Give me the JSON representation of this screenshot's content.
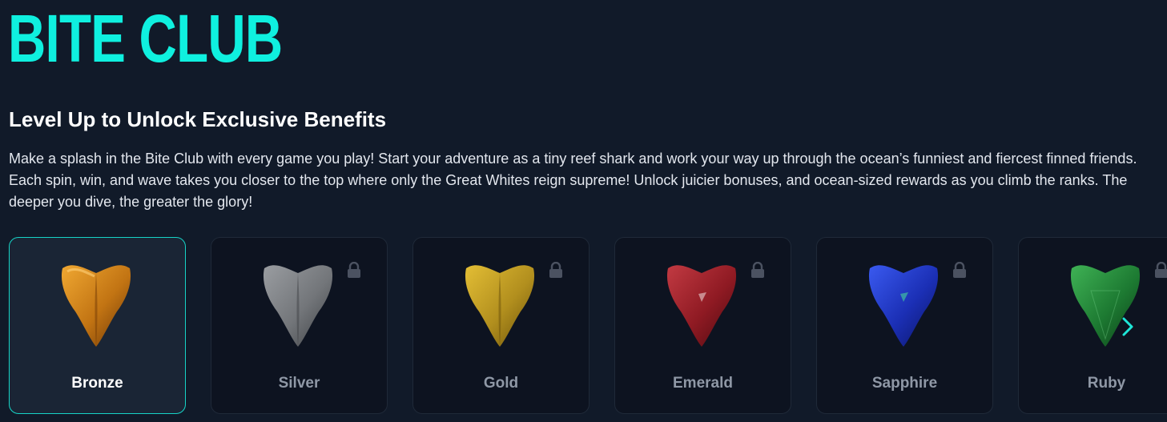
{
  "brand": {
    "title": "BITE CLUB",
    "accent_color": "#0ff0df"
  },
  "intro": {
    "heading": "Level Up to Unlock Exclusive Benefits",
    "description": "Make a splash in the Bite Club with every game you play! Start your adventure as a tiny reef shark and work your way up through the ocean’s funniest and fiercest finned friends. Each spin, win, and wave takes you closer to the top where only the Great Whites reign supreme! Unlock juicier bonuses, and ocean-sized rewards as you climb the ranks. The deeper you dive, the greater the glory!"
  },
  "tiers": [
    {
      "label": "Bronze",
      "locked": false,
      "selected": true,
      "color": "#c98419"
    },
    {
      "label": "Silver",
      "locked": true,
      "selected": false,
      "color": "#8a8d91"
    },
    {
      "label": "Gold",
      "locked": true,
      "selected": false,
      "color": "#c9a225"
    },
    {
      "label": "Emerald",
      "locked": true,
      "selected": false,
      "color": "#a6202a"
    },
    {
      "label": "Sapphire",
      "locked": true,
      "selected": false,
      "color": "#1f36c4"
    },
    {
      "label": "Ruby",
      "locked": true,
      "selected": false,
      "color": "#1f8a36"
    }
  ],
  "icons": {
    "tier_badge": "shark-tooth-icon",
    "lock": "lock-icon",
    "carousel_next": "chevron-right-icon"
  }
}
